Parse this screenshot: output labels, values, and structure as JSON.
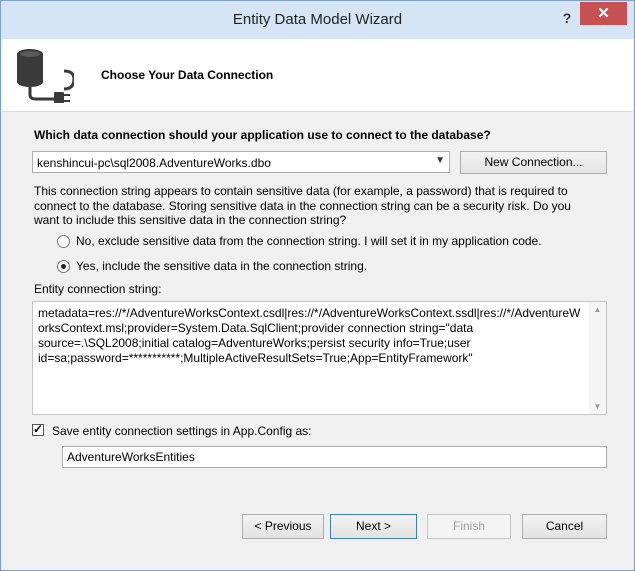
{
  "window": {
    "title": "Entity Data Model Wizard",
    "help_glyph": "?",
    "close_glyph": "✕"
  },
  "header": {
    "title": "Choose Your Data Connection",
    "icon": "database-plug-icon"
  },
  "connection": {
    "question": "Which data connection should your application use to connect to the database?",
    "selected": "kenshincui-pc\\sql2008.AdventureWorks.dbo",
    "new_connection_label": "New Connection..."
  },
  "sensitive": {
    "warning": "This connection string appears to contain sensitive data (for example, a password) that is required to connect to the database. Storing sensitive data in the connection string can be a security risk. Do you want to include this sensitive data in the connection string?",
    "option_exclude": "No, exclude sensitive data from the connection string. I will set it in my application code.",
    "option_include": "Yes, include the sensitive data in the connection string.",
    "selected": "include"
  },
  "entity_connection": {
    "label": "Entity connection string:",
    "value": "metadata=res://*/AdventureWorksContext.csdl|res://*/AdventureWorksContext.ssdl|res://*/AdventureWorksContext.msl;provider=System.Data.SqlClient;provider connection string=\"data source=.\\SQL2008;initial catalog=AdventureWorks;persist security info=True;user id=sa;password=***********;MultipleActiveResultSets=True;App=EntityFramework\""
  },
  "save_settings": {
    "checked": true,
    "label": "Save entity connection settings in App.Config as:",
    "value": "AdventureWorksEntities"
  },
  "buttons": {
    "previous": "< Previous",
    "next": "Next >",
    "finish": "Finish",
    "cancel": "Cancel"
  }
}
